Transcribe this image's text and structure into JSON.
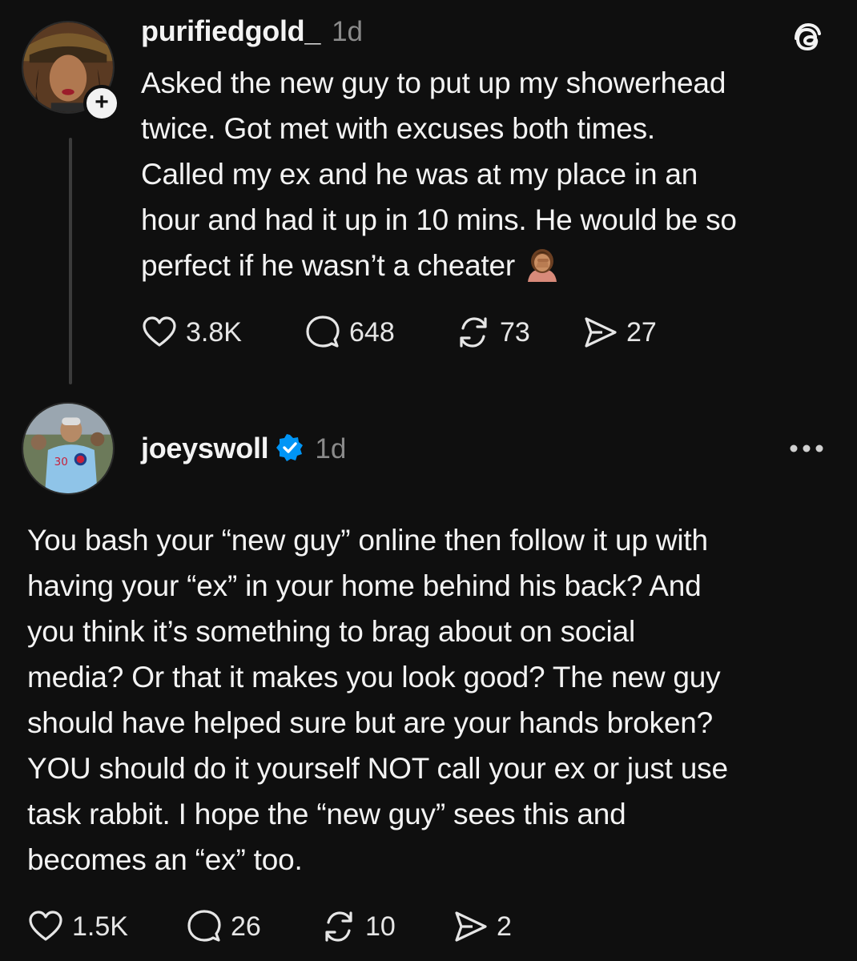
{
  "post1": {
    "username": "purifiedgold_",
    "time": "1d",
    "lines": [
      "Asked the new guy to put up my showerhead",
      "twice. Got met with excuses both times.",
      "Called my ex and he was at my place in an",
      "hour and had it up in 10 mins. He would be so",
      "perfect if he wasn’t a cheater"
    ],
    "emoji": "face-palm-emoji",
    "likes": "3.8K",
    "replies": "648",
    "reposts": "73",
    "shares": "27"
  },
  "post2": {
    "username": "joeyswoll",
    "verified": true,
    "time": "1d",
    "lines": [
      "You bash your “new guy” online then follow it up with",
      "having your “ex” in your home behind his back? And",
      "you think it’s something to brag about on social",
      "media? Or that it makes you look good? The new guy",
      "should have helped sure but are your hands broken?",
      "YOU should do it yourself NOT call your ex or just use",
      "task rabbit. I hope the “new guy” sees this and",
      "becomes an “ex” too."
    ],
    "likes": "1.5K",
    "replies": "26",
    "reposts": "10",
    "shares": "2"
  },
  "colors": {
    "background": "#0f0f0f",
    "text": "#f3f3f3",
    "muted": "#8a8a8a",
    "verified_blue": "#0095f6"
  }
}
